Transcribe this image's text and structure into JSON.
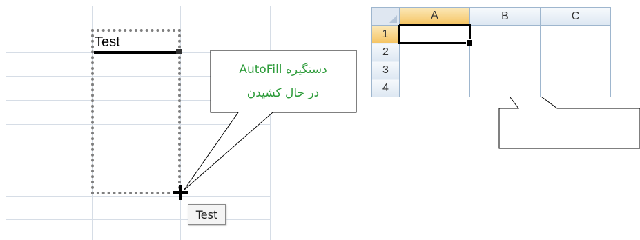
{
  "left_sheet": {
    "cell_text": "Test",
    "tooltip_text": "Test",
    "callout_lines": [
      "دستگیره AutoFill",
      "در حال کشیدن"
    ]
  },
  "right_sheet": {
    "columns": [
      "A",
      "B",
      "C"
    ],
    "rows": [
      "1",
      "2",
      "3",
      "4"
    ],
    "active_cell": "A1"
  },
  "icons": {
    "cursor": "crosshair-plus-icon",
    "fill_handle": "fill-handle-icon"
  },
  "colors": {
    "callout_text": "#2e9c3b",
    "selection_header": "#f5c463",
    "grid": "#d6dde6"
  }
}
